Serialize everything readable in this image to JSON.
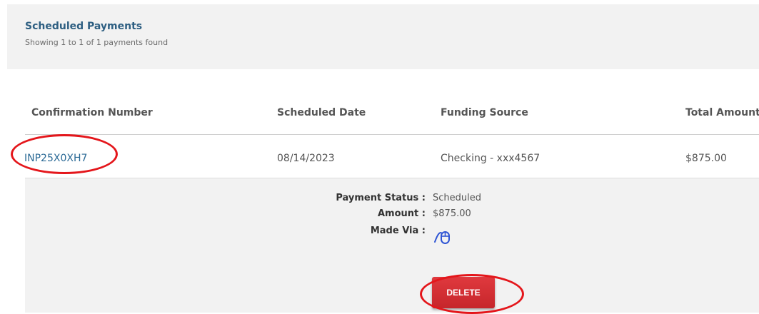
{
  "panel": {
    "title": "Scheduled Payments",
    "subtitle": "Showing 1 to 1 of 1 payments found"
  },
  "table": {
    "headers": {
      "confirmation": "Confirmation Number",
      "date": "Scheduled Date",
      "funding": "Funding Source",
      "total": "Total Amount"
    },
    "rows": [
      {
        "confirmation": "INP25X0XH7",
        "date": "08/14/2023",
        "funding": "Checking - xxx4567",
        "total": "$875.00"
      }
    ]
  },
  "details": {
    "status_label": "Payment Status :",
    "status_value": "Scheduled",
    "amount_label": "Amount :",
    "amount_value": "$875.00",
    "made_via_label": "Made Via :",
    "made_via_icon": "mouse-icon"
  },
  "actions": {
    "delete_label": "DELETE"
  },
  "colors": {
    "link": "#2b6a96",
    "title": "#2e5f82",
    "delete_button": "#d32f33",
    "annotation": "#e4161b",
    "mouse_icon": "#2f55d4"
  }
}
